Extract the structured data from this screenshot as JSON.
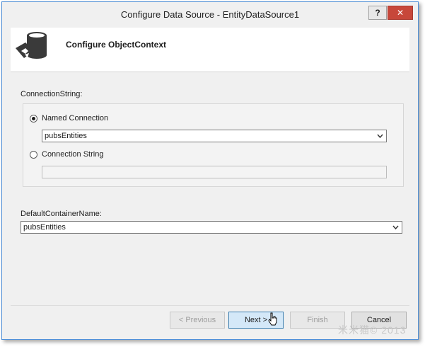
{
  "window": {
    "title": "Configure Data Source - EntityDataSource1"
  },
  "title_buttons": {
    "help": "?",
    "close": "✕"
  },
  "header": {
    "title": "Configure ObjectContext",
    "icon": "database-config-icon"
  },
  "connection": {
    "label": "ConnectionString:",
    "named_label": "Named Connection",
    "named_selected": true,
    "named_value": "pubsEntities",
    "string_label": "Connection String",
    "string_selected": false,
    "string_value": ""
  },
  "container": {
    "label": "DefaultContainerName:",
    "value": "pubsEntities"
  },
  "footer": {
    "previous": "< Previous",
    "next": "Next >",
    "finish": "Finish",
    "cancel": "Cancel"
  },
  "watermark": "米米猫© 2013",
  "colors": {
    "accent": "#4a8cd6",
    "close": "#c7473a",
    "default_button": "#d4e8f8"
  }
}
